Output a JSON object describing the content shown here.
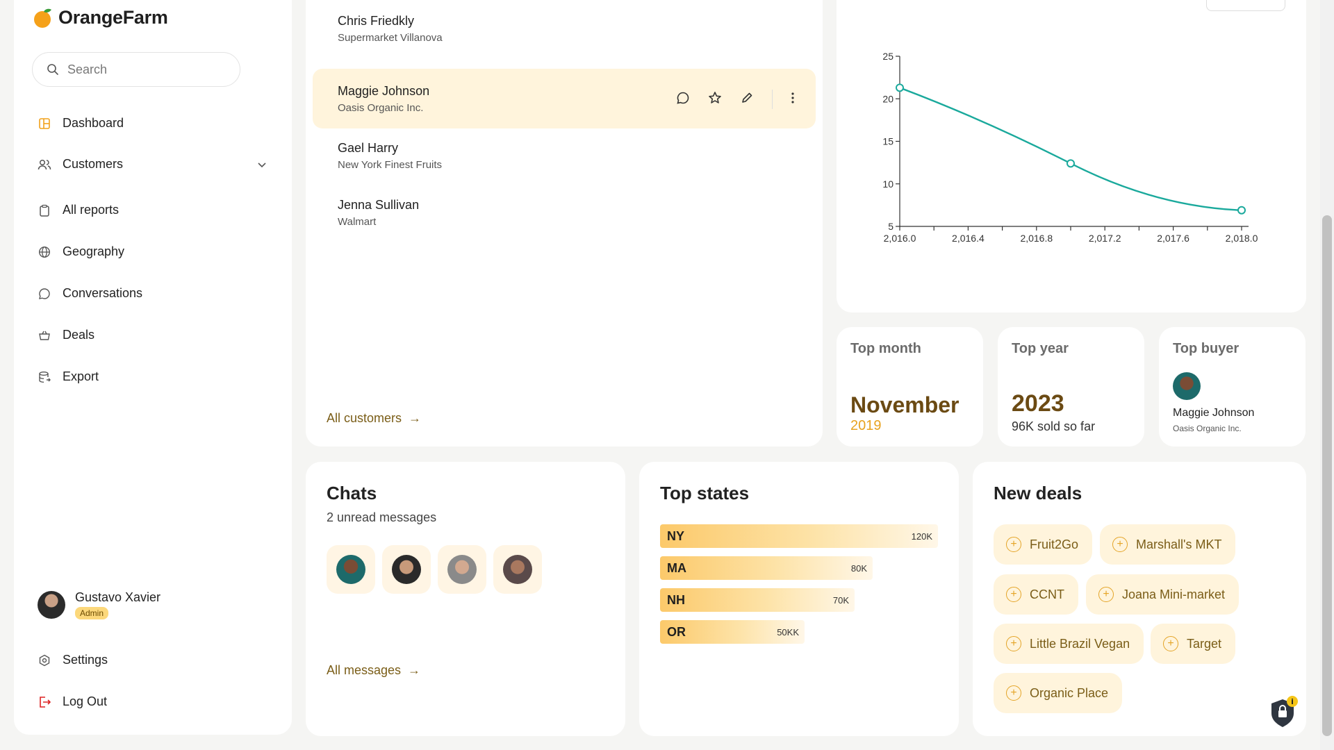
{
  "brand": {
    "name": "OrangeFarm"
  },
  "search": {
    "placeholder": "Search"
  },
  "nav": {
    "items": [
      {
        "label": "Dashboard",
        "icon": "dashboard-icon"
      },
      {
        "label": "Customers",
        "icon": "users-icon"
      },
      {
        "label": "All reports",
        "icon": "clipboard-icon"
      },
      {
        "label": "Geography",
        "icon": "globe-icon"
      },
      {
        "label": "Conversations",
        "icon": "chat-icon"
      },
      {
        "label": "Deals",
        "icon": "basket-icon"
      },
      {
        "label": "Export",
        "icon": "database-export-icon"
      }
    ],
    "settings": "Settings",
    "logout": "Log Out"
  },
  "user": {
    "name": "Gustavo Xavier",
    "role": "Admin"
  },
  "customers": {
    "rows": [
      {
        "name": "Chris Friedkly",
        "company": "Supermarket Villanova"
      },
      {
        "name": "Maggie Johnson",
        "company": "Oasis Organic Inc."
      },
      {
        "name": "Gael Harry",
        "company": "New York Finest Fruits"
      },
      {
        "name": "Jenna Sullivan",
        "company": "Walmart"
      }
    ],
    "all_link": "All customers"
  },
  "chart_data": {
    "type": "line",
    "x": [
      2016.0,
      2017.0,
      2018.0
    ],
    "series": [
      {
        "values": [
          21.3,
          12.4,
          6.9
        ],
        "color": "#1aa99c"
      }
    ],
    "xlim": [
      2016.0,
      2018.0
    ],
    "ylim": [
      5,
      25
    ],
    "x_ticks": [
      "2,016.0",
      "2,016.4",
      "2,016.8",
      "2,017.2",
      "2,017.6",
      "2,018.0"
    ],
    "y_ticks": [
      "5",
      "10",
      "15",
      "20",
      "25"
    ],
    "grid": false
  },
  "stats": {
    "top_month": {
      "title": "Top month",
      "value": "November",
      "sub": "2019"
    },
    "top_year": {
      "title": "Top year",
      "value": "2023",
      "sub": "96K sold so far"
    },
    "top_buyer": {
      "title": "Top buyer",
      "name": "Maggie Johnson",
      "company": "Oasis Organic Inc."
    }
  },
  "chats": {
    "title": "Chats",
    "subtitle": "2 unread messages",
    "all_link": "All messages"
  },
  "top_states": {
    "title": "Top states",
    "rows": [
      {
        "abbr": "NY",
        "value": "120K",
        "fraction": 1.0
      },
      {
        "abbr": "MA",
        "value": "80K",
        "fraction": 0.765
      },
      {
        "abbr": "NH",
        "value": "70K",
        "fraction": 0.7
      },
      {
        "abbr": "OR",
        "value": "50KK",
        "fraction": 0.52
      }
    ]
  },
  "new_deals": {
    "title": "New deals",
    "items": [
      "Fruit2Go",
      "Marshall's MKT",
      "CCNT",
      "Joana Mini-market",
      "Little Brazil Vegan",
      "Target",
      "Organic Place"
    ]
  },
  "colors": {
    "accent": "#f2a21b",
    "brand_brown": "#7a5d17",
    "teal": "#1aa99c",
    "highlight": "#fff4dc"
  }
}
